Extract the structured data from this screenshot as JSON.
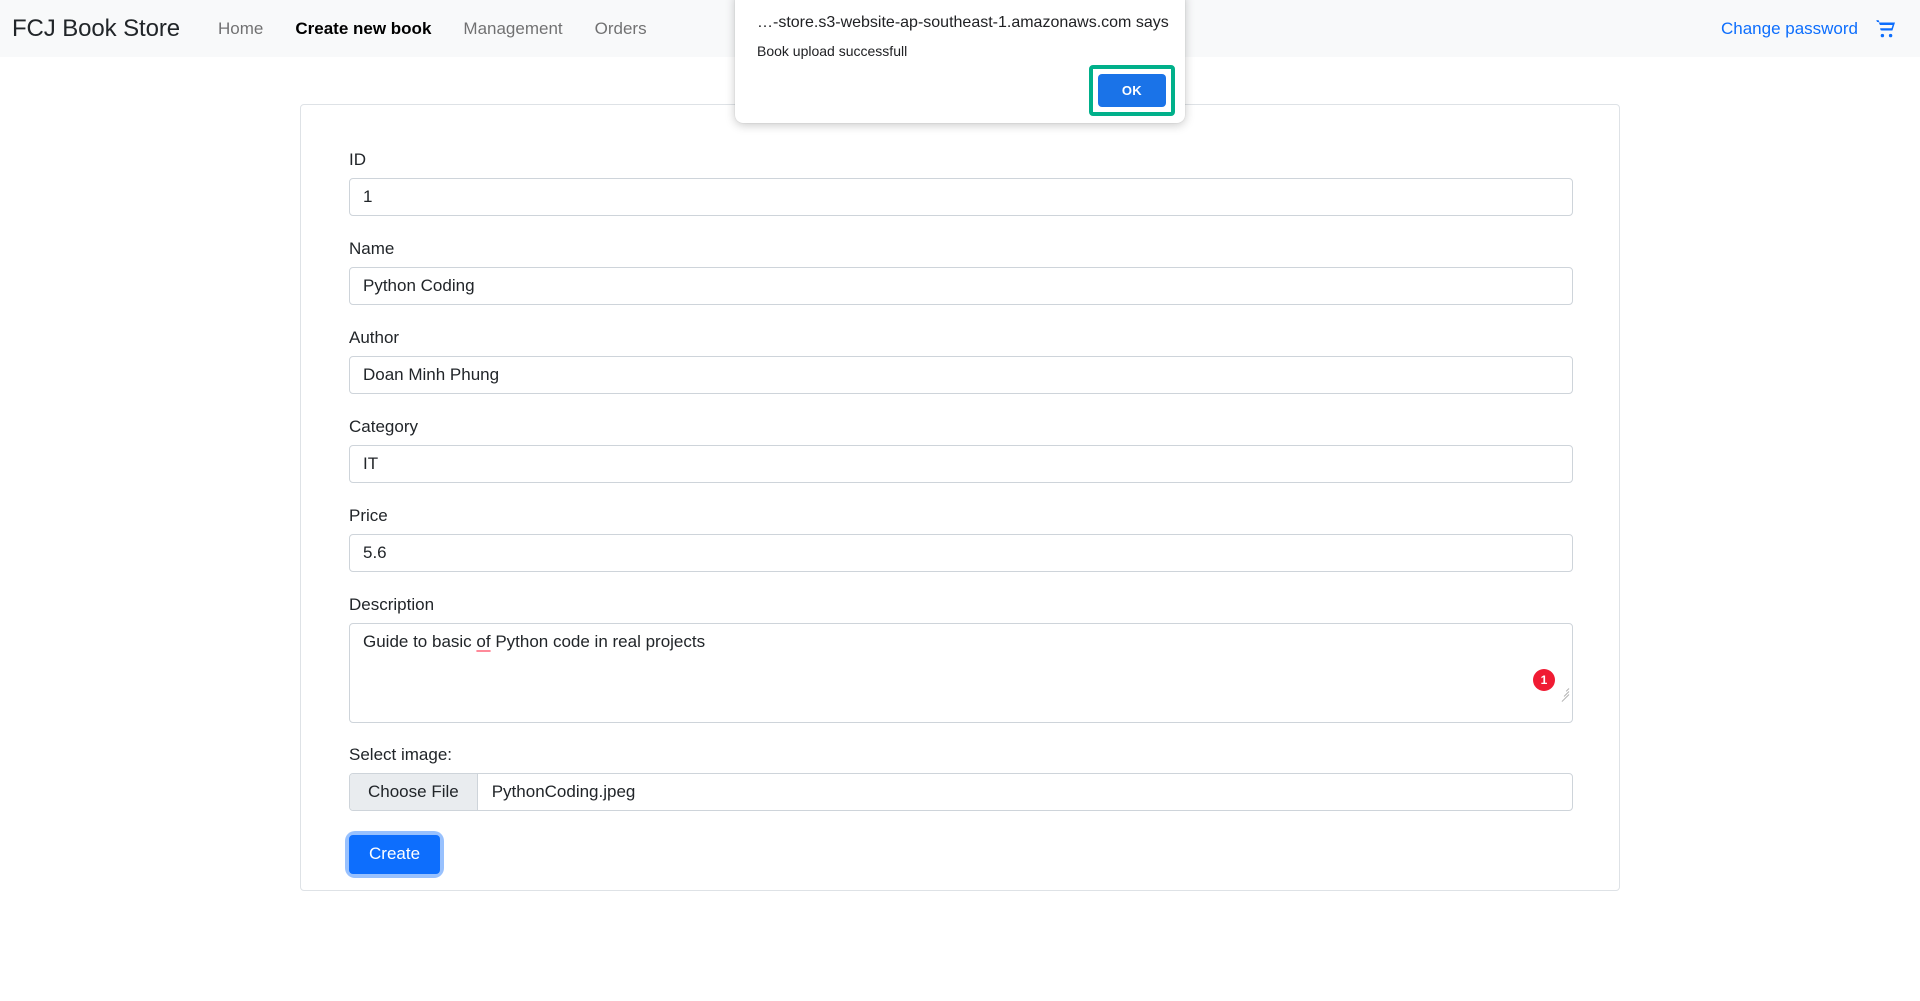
{
  "navbar": {
    "brand": "FCJ Book Store",
    "links": [
      {
        "label": "Home",
        "active": false
      },
      {
        "label": "Create new book",
        "active": true
      },
      {
        "label": "Management",
        "active": false
      },
      {
        "label": "Orders",
        "active": false
      }
    ],
    "change_password_label": "Change password",
    "cart_icon": "shopping-cart-icon",
    "background_color": "#f8f9fa",
    "link_color": "#0d6efd"
  },
  "form": {
    "fields": [
      {
        "label": "ID",
        "value": "1"
      },
      {
        "label": "Name",
        "value": "Python Coding"
      },
      {
        "label": "Author",
        "value": "Doan Minh Phung"
      },
      {
        "label": "Category",
        "value": "IT"
      },
      {
        "label": "Price",
        "value": "5.6"
      }
    ],
    "description": {
      "label": "Description",
      "text_before": "Guide to basic ",
      "misspelled_word": "of",
      "text_after": " Python code in real projects",
      "full_value": "Guide to basic of Python code in real projects",
      "grammar_badge_count": "1",
      "grammar_badge_color": "#f01b33"
    },
    "file": {
      "label": "Select image:",
      "button_label": "Choose File",
      "file_name": "PythonCoding.jpeg"
    },
    "submit_label": "Create",
    "submit_color": "#0d6efd"
  },
  "dialog": {
    "title": "…-store.s3-website-ap-southeast-1.amazonaws.com says",
    "message": "Book upload successfull",
    "ok_label": "OK",
    "ok_color": "#1a73e8",
    "highlight_color": "#00b08a"
  }
}
